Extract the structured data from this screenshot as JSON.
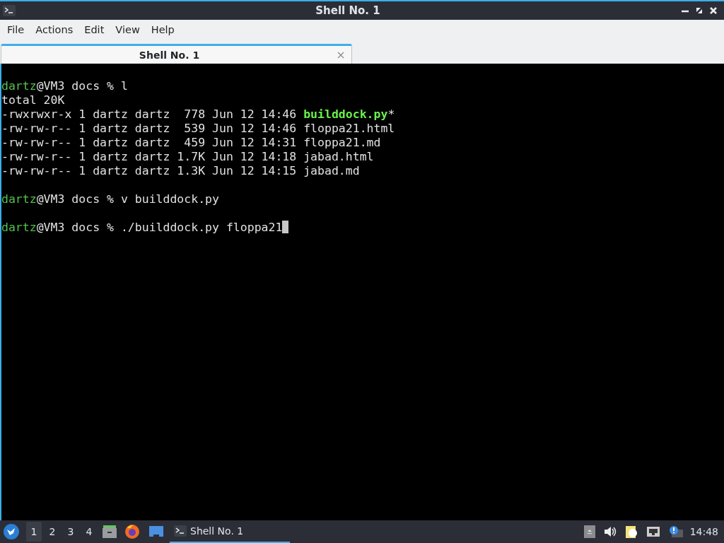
{
  "window": {
    "title": "Shell No. 1"
  },
  "menu": [
    "File",
    "Actions",
    "Edit",
    "View",
    "Help"
  ],
  "tabs": [
    {
      "label": "Shell No. 1",
      "selected": true
    }
  ],
  "terminal": {
    "lines": [
      {
        "kind": "prompt",
        "user": "dartz",
        "rest": "@VM3 docs % ",
        "command": "l",
        "cursor": false
      },
      {
        "kind": "output",
        "text": "total 20K"
      },
      {
        "kind": "listing",
        "text": "-rwxrwxr-x 1 dartz dartz  778 Jun 12 14:46 ",
        "file": "builddock.py",
        "executable": true,
        "suffix": "*"
      },
      {
        "kind": "listing",
        "text": "-rw-rw-r-- 1 dartz dartz  539 Jun 12 14:46 ",
        "file": "floppa21.html",
        "executable": false
      },
      {
        "kind": "listing",
        "text": "-rw-rw-r-- 1 dartz dartz  459 Jun 12 14:31 ",
        "file": "floppa21.md",
        "executable": false
      },
      {
        "kind": "listing",
        "text": "-rw-rw-r-- 1 dartz dartz 1.7K Jun 12 14:18 ",
        "file": "jabad.html",
        "executable": false
      },
      {
        "kind": "listing",
        "text": "-rw-rw-r-- 1 dartz dartz 1.3K Jun 12 14:15 ",
        "file": "jabad.md",
        "executable": false
      },
      {
        "kind": "prompt",
        "user": "dartz",
        "rest": "@VM3 docs % ",
        "command": "v builddock.py",
        "cursor": false
      },
      {
        "kind": "prompt",
        "user": "dartz",
        "rest": "@VM3 docs % ",
        "command": "./builddock.py floppa21",
        "cursor": true
      }
    ]
  },
  "taskbar": {
    "workspaces": [
      {
        "label": "1",
        "selected": true
      },
      {
        "label": "2",
        "selected": false
      },
      {
        "label": "3",
        "selected": false
      },
      {
        "label": "4",
        "selected": false
      }
    ],
    "tasks": [
      {
        "label": "Shell No. 1",
        "selected": true
      }
    ],
    "clock": "14:48"
  }
}
